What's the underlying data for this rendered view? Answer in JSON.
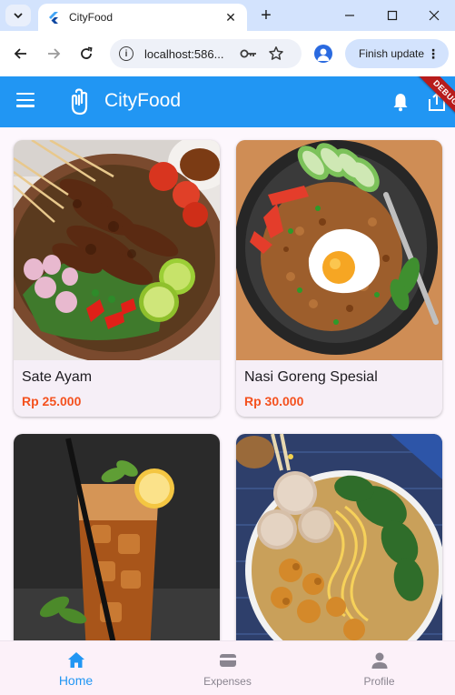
{
  "browser": {
    "tab_title": "CityFood",
    "url": "localhost:586...",
    "finish_update_label": "Finish update"
  },
  "app": {
    "title": "CityFood",
    "debug_label": "DEBUG",
    "products": [
      {
        "name": "Sate Ayam",
        "price": "Rp 25.000"
      },
      {
        "name": "Nasi Goreng Spesial",
        "price": "Rp 30.000"
      },
      {
        "name": "",
        "price": ""
      },
      {
        "name": "",
        "price": ""
      }
    ],
    "nav": [
      {
        "label": "Home",
        "icon": "home-icon",
        "active": true
      },
      {
        "label": "Expenses",
        "icon": "wallet-icon",
        "active": false
      },
      {
        "label": "Profile",
        "icon": "person-icon",
        "active": false
      }
    ]
  },
  "colors": {
    "app_bar": "#2196f3",
    "price": "#f4511e",
    "active_nav": "#2196f3",
    "browser_frame": "#d3e3fd"
  }
}
